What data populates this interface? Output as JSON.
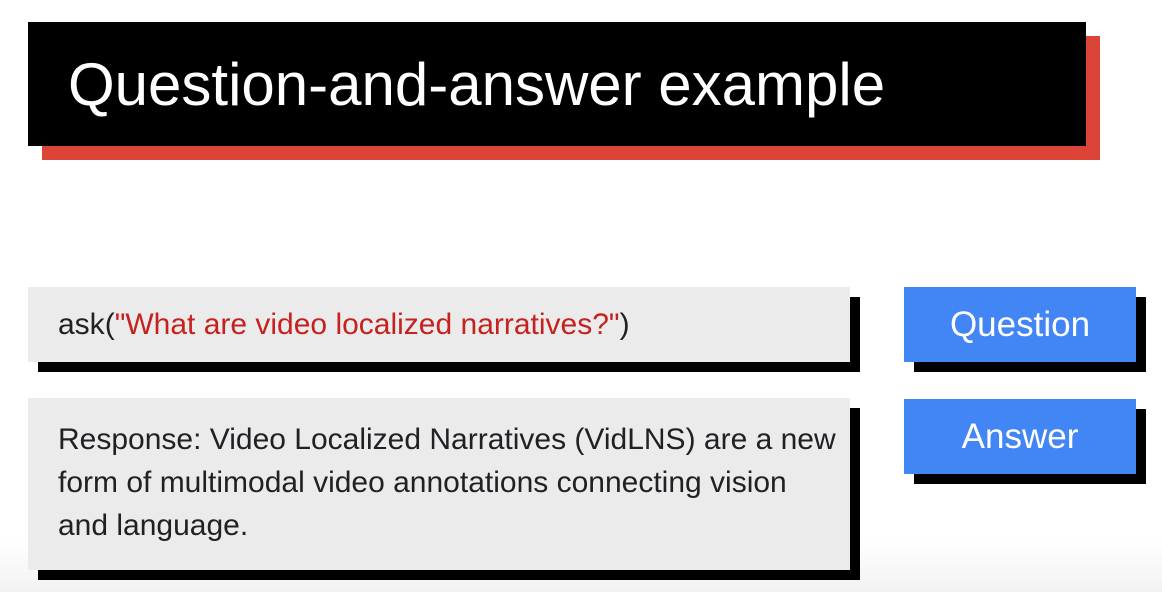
{
  "title": "Question-and-answer example",
  "question": {
    "function_name": "ask",
    "open_paren": "(",
    "argument": "\"What are video localized narratives?\"",
    "close_paren": ")"
  },
  "answer": {
    "text": "Response: Video Localized Narratives (VidLNS) are a new form of multimodal video annotations connecting vision and language."
  },
  "labels": {
    "question": "Question",
    "answer": "Answer"
  },
  "colors": {
    "title_background": "#000000",
    "title_accent": "#db4437",
    "label_background": "#4285f4",
    "panel_background": "#ebebeb",
    "string_literal": "#c5221f"
  }
}
